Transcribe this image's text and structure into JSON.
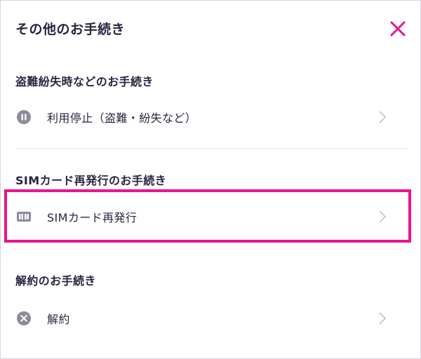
{
  "dialog": {
    "title": "その他のお手続き",
    "close_icon": "close-icon",
    "accent_color": "#ea148c"
  },
  "sections": [
    {
      "heading": "盗難紛失時などのお手続き",
      "items": [
        {
          "label": "利用停止（盗難・紛失など）",
          "icon": "pause-icon"
        }
      ]
    },
    {
      "heading": "SIMカード再発行のお手続き",
      "items": [
        {
          "label": "SIMカード再発行",
          "icon": "sim-card-icon",
          "highlighted": true
        }
      ]
    },
    {
      "heading": "解約のお手続き",
      "items": [
        {
          "label": "解約",
          "icon": "cancel-icon"
        }
      ]
    }
  ]
}
